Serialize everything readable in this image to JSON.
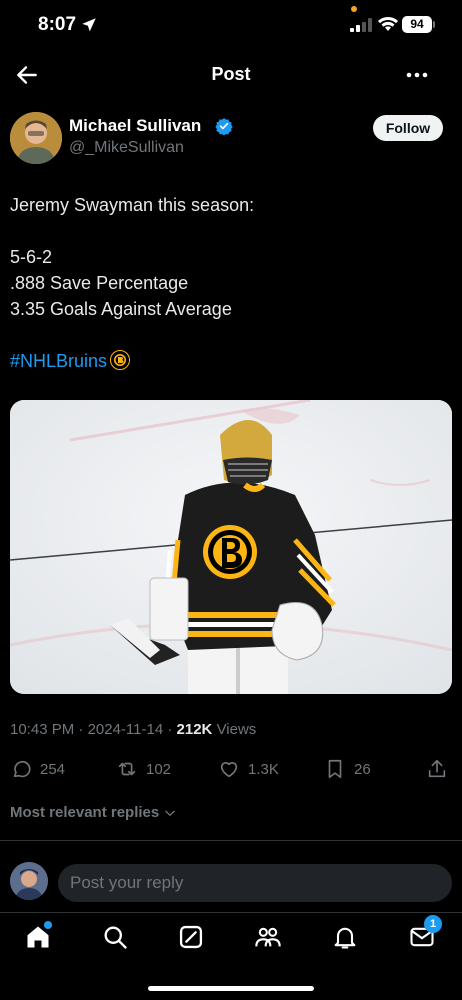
{
  "status_bar": {
    "time": "8:07",
    "battery": "94"
  },
  "header": {
    "title": "Post"
  },
  "author": {
    "name": "Michael Sullivan",
    "handle": "@_MikeSullivan",
    "follow_label": "Follow"
  },
  "tweet": {
    "line1": "Jeremy Swayman this season:",
    "line2": "5-6-2",
    "line3": ".888 Save Percentage",
    "line4": "3.35 Goals Against Average",
    "hashtag": "#NHLBruins"
  },
  "meta": {
    "time": "10:43 PM",
    "date": "2024-11-14",
    "views_count": "212K",
    "views_label": "Views"
  },
  "actions": {
    "replies": "254",
    "reposts": "102",
    "likes": "1.3K",
    "bookmarks": "26"
  },
  "replies_sort_label": "Most relevant replies",
  "reply_bar": {
    "placeholder": "Post your reply"
  },
  "tabbar": {
    "messages_badge": "1"
  },
  "colors": {
    "accent": "#1d9bf0",
    "background": "#000000",
    "muted": "#71767b",
    "bruins_gold": "#fcb514"
  },
  "icons": [
    "location-arrow-icon",
    "signal-icon",
    "wifi-icon",
    "back-arrow-icon",
    "more-icon",
    "verified-icon",
    "bruins-logo-icon",
    "reply-icon",
    "repost-icon",
    "like-icon",
    "bookmark-icon",
    "share-icon",
    "chevron-down-icon",
    "home-icon",
    "search-icon",
    "grok-icon",
    "communities-icon",
    "notifications-icon",
    "messages-icon"
  ]
}
